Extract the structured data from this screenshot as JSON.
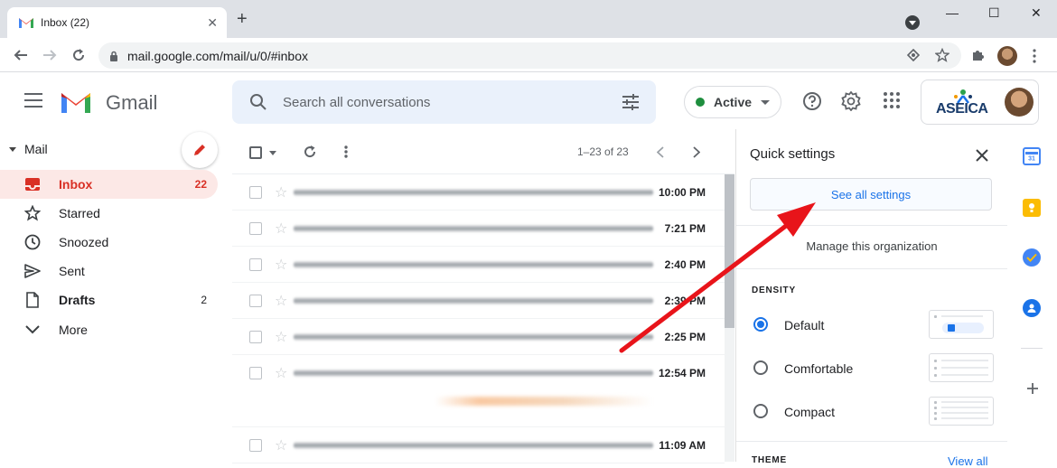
{
  "browser": {
    "tab_title": "Inbox (22)",
    "tab_close": "✕",
    "new_tab": "+",
    "window_minimize": "—",
    "window_maximize": "☐",
    "window_close": "✕",
    "url": "mail.google.com/mail/u/0/#inbox"
  },
  "gmail": {
    "product_name": "Gmail",
    "search_placeholder": "Search all conversations",
    "status_label": "Active",
    "status_color": "#1e8e3e",
    "org_name": "ASEICA"
  },
  "sidebar": {
    "section_label": "Mail",
    "items": [
      {
        "label": "Inbox",
        "count": "22",
        "icon": "inbox-icon",
        "active": true
      },
      {
        "label": "Starred",
        "count": "",
        "icon": "star-icon"
      },
      {
        "label": "Snoozed",
        "count": "",
        "icon": "clock-icon"
      },
      {
        "label": "Sent",
        "count": "",
        "icon": "send-icon"
      },
      {
        "label": "Drafts",
        "count": "2",
        "icon": "draft-icon"
      },
      {
        "label": "More",
        "count": "",
        "icon": "chevron-down-icon"
      }
    ]
  },
  "list": {
    "pagination": "1–23 of 23",
    "rows": [
      {
        "time": "10:00 PM"
      },
      {
        "time": "7:21 PM"
      },
      {
        "time": "2:40 PM"
      },
      {
        "time": "2:39 PM"
      },
      {
        "time": "2:25 PM"
      },
      {
        "time": "12:54 PM"
      },
      {
        "time": "11:09 AM"
      }
    ]
  },
  "quick_settings": {
    "title": "Quick settings",
    "see_all_settings": "See all settings",
    "manage_org": "Manage this organization",
    "density_heading": "DENSITY",
    "density_options": [
      {
        "label": "Default",
        "selected": true
      },
      {
        "label": "Comfortable",
        "selected": false
      },
      {
        "label": "Compact",
        "selected": false
      }
    ],
    "theme_heading": "THEME",
    "view_all": "View all"
  },
  "annotation": {
    "color": "#e8141a"
  }
}
